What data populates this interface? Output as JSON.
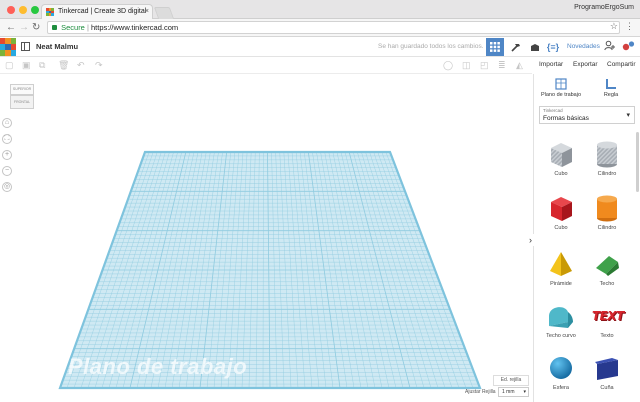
{
  "browser": {
    "tab_title": "Tinkercad | Create 3D digital",
    "tab_close": "×",
    "profile": "ProgramoErgoSum",
    "secure_label": "Secure",
    "url_separator": "|",
    "url": "https://www.tinkercad.com"
  },
  "app": {
    "logo_letters": [
      "TIN",
      "KER",
      "CAD"
    ],
    "design_name": "Neat Malmu",
    "saved_message": "Se han guardado todos los cambios.",
    "novedades": "Novedades",
    "brand_colors": [
      "#e64930",
      "#f29122",
      "#7bb339",
      "#29a9e0",
      "#2e6cb5"
    ]
  },
  "side_actions": {
    "import": "Importar",
    "export": "Exportar",
    "share": "Compartir"
  },
  "viewcube": {
    "top": "SUPERIOR",
    "front": "FRONTAL"
  },
  "workspace": {
    "plane_label": "Plano de trabajo",
    "edit_grid": "Ed. rejilla",
    "snap_label": "Ajustar Rejilla",
    "snap_value": "1 mm"
  },
  "panel": {
    "workplane_label": "Plano de trabajo",
    "ruler_label": "Regla",
    "library_source": "Tinkercad",
    "library_name": "Formas básicas",
    "shapes": [
      {
        "label": "Cubo",
        "color": "#9aa0a8"
      },
      {
        "label": "Cilindro",
        "color": "#9aa0a8"
      },
      {
        "label": "Cubo",
        "color": "#d7262d"
      },
      {
        "label": "Cilindro",
        "color": "#f08a1e"
      },
      {
        "label": "Pirámide",
        "color": "#f3c31b"
      },
      {
        "label": "Techo",
        "color": "#3fa14a"
      },
      {
        "label": "Techo curvo",
        "color": "#4fb8c9"
      },
      {
        "label": "Texto",
        "color": "#d7262d"
      },
      {
        "label": "Esfera",
        "color": "#1f8ed2"
      },
      {
        "label": "Cuña",
        "color": "#27398f"
      }
    ],
    "text_shape_word": "TEXT"
  },
  "colors": {
    "accent": "#4f86c6",
    "grid": "#cfe9f3"
  }
}
